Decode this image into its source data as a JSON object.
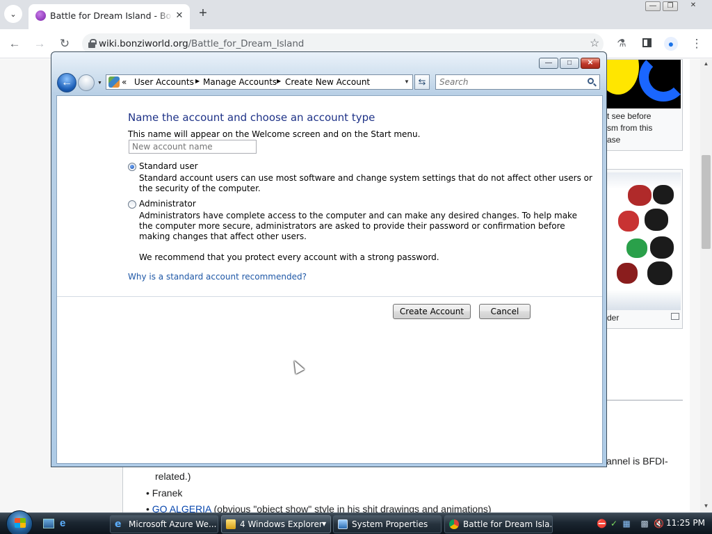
{
  "browser": {
    "tab_title": "Battle for Dream Island - BonziWorld",
    "url_host": "wiki.bonziworld.org",
    "url_path": "/Battle_for_Dream_Island"
  },
  "webpage": {
    "caption1_lines": [
      "t see before",
      "sm from this",
      "ase"
    ],
    "caption2": "der",
    "snippet_right": "annel is BFDI-",
    "snippet_related": "related.)",
    "bullet1": "Franek",
    "bullet2_link": "GO ALGERIA",
    "bullet2_rest": " (obvious \"object show\" style in his shit drawings and animations)"
  },
  "explorer": {
    "breadcrumbs": [
      "User Accounts",
      "Manage Accounts",
      "Create New Account"
    ],
    "search_placeholder": "Search"
  },
  "dialog": {
    "heading": "Name the account and choose an account type",
    "subtitle": "This name will appear on the Welcome screen and on the Start menu.",
    "name_placeholder": "New account name",
    "standard_label": "Standard user",
    "standard_desc_1": "Standard account users can use most software and change system settings that do not affect other users or",
    "standard_desc_2": "the security of the computer.",
    "admin_label": "Administrator",
    "admin_desc_1": "Administrators have complete access to the computer and can make any desired changes. To help make",
    "admin_desc_2": "the computer more secure, administrators are asked to provide their password or confirmation before",
    "admin_desc_3": "making changes that affect other users.",
    "recommend": "We recommend that you protect every account with a strong password.",
    "why_link": "Why is a standard account recommended?",
    "create_button": "Create Account",
    "cancel_button": "Cancel",
    "selected_type": "Standard user"
  },
  "taskbar": {
    "buttons": [
      {
        "label": "Microsoft Azure We...",
        "icon": "ie-icon"
      },
      {
        "label": "4 Windows Explorer",
        "icon": "folder-icon"
      },
      {
        "label": "System Properties",
        "icon": "system-properties-icon"
      },
      {
        "label": "Battle for Dream Isla...",
        "icon": "chrome-icon"
      }
    ],
    "clock": "11:25 PM"
  },
  "colors": {
    "heading_blue": "#1e3287",
    "link_blue": "#1e57a6",
    "web_link": "#0645ad"
  }
}
